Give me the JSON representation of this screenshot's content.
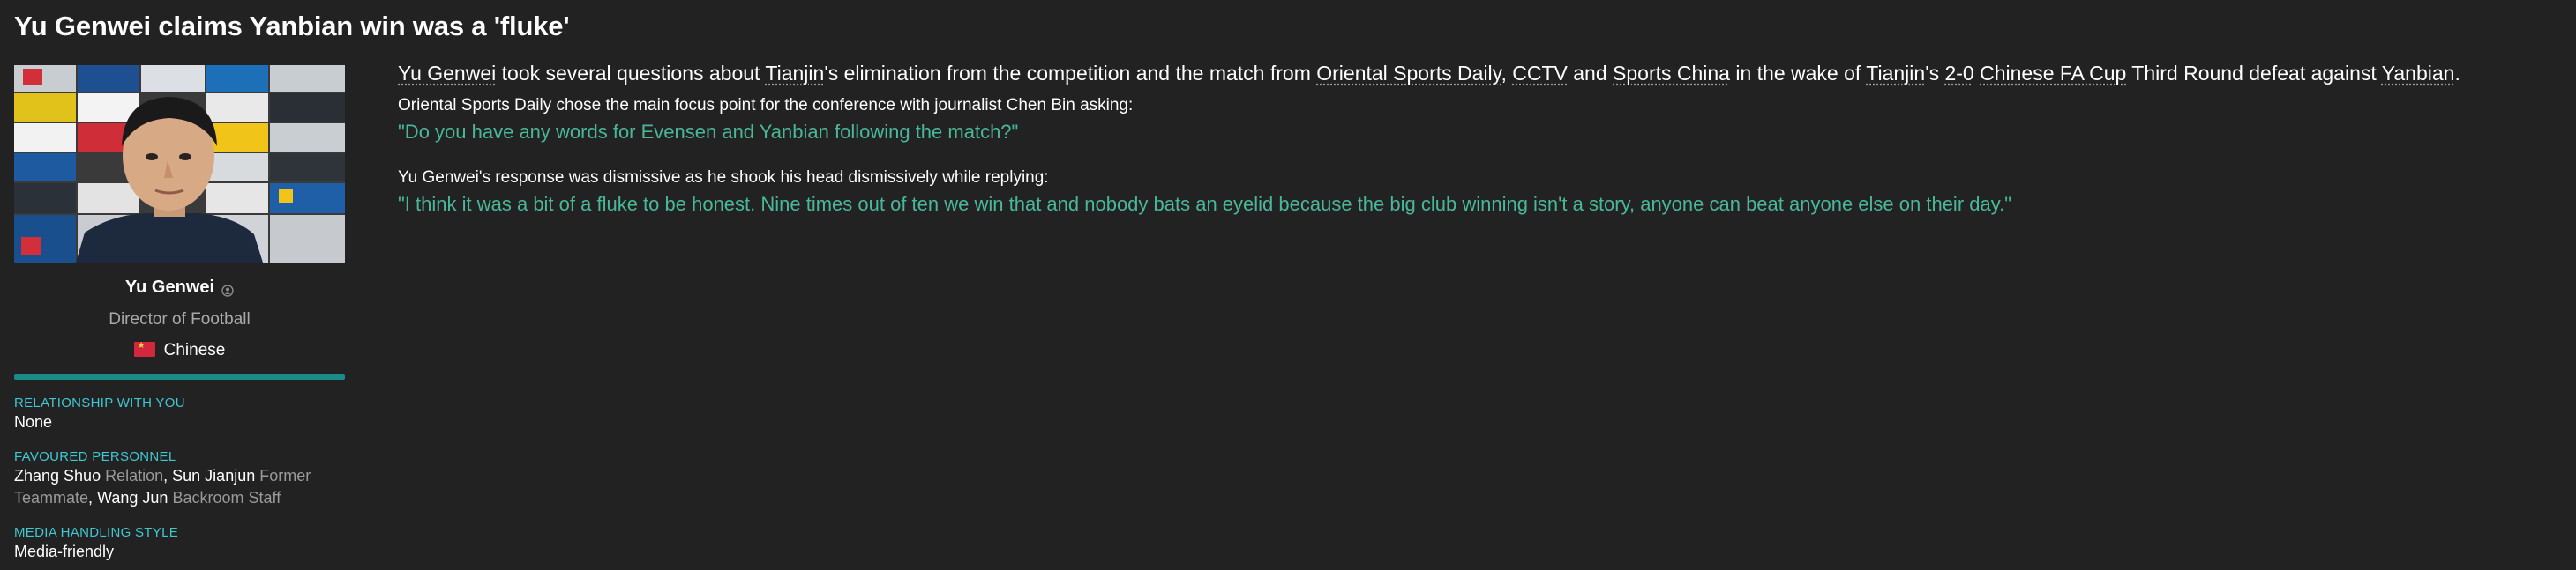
{
  "headline": "Yu Genwei claims Yanbian win was a 'fluke'",
  "profile": {
    "name": "Yu Genwei",
    "role": "Director of Football",
    "nationality": "Chinese",
    "icons": {
      "person": "person-icon",
      "flag": "china-flag-icon"
    }
  },
  "sections": {
    "relationship": {
      "title": "RELATIONSHIP WITH YOU",
      "value": "None"
    },
    "favoured": {
      "title": "FAVOURED PERSONNEL",
      "people": [
        {
          "name": "Zhang Shuo",
          "type": "Relation"
        },
        {
          "name": "Sun Jianjun",
          "type": "Former Teammate"
        },
        {
          "name": "Wang Jun",
          "type": "Backroom Staff"
        }
      ],
      "separator": ", "
    },
    "media": {
      "title": "MEDIA HANDLING STYLE",
      "value": "Media-friendly"
    }
  },
  "article": {
    "lead": {
      "p1": "Yu Genwei",
      "p2": " took several questions about ",
      "p3": "Tianjin",
      "p4": "'s elimination from the competition and the match from ",
      "p5": "Oriental Sports Daily",
      "p6": ", ",
      "p7": "CCTV",
      "p8": " and ",
      "p9": "Sports China",
      "p10": " in the wake of ",
      "p11": "Tianjin",
      "p12": "'s ",
      "p13": "2-0",
      "p14": " ",
      "p15": "Chinese FA Cup",
      "p16": " Third Round defeat against ",
      "p17": "Yanbian",
      "p18": "."
    },
    "q1_intro": "Oriental Sports Daily chose the main focus point for the conference with journalist Chen Bin asking:",
    "q1": "\"Do you have any words for Evensen and Yanbian following the match?\"",
    "q2_intro": "Yu Genwei's response was dismissive as he shook his head dismissively while replying:",
    "q2": "\"I think it was a bit of a fluke to be honest. Nine times out of ten we win that and nobody bats an eyelid because the big club winning isn't a story, anyone can beat anyone else on their day.\""
  },
  "colors": {
    "accent_teal": "#1a8a8a",
    "section_title": "#3fc8d2",
    "quote": "#49b79a",
    "background": "#222222"
  }
}
